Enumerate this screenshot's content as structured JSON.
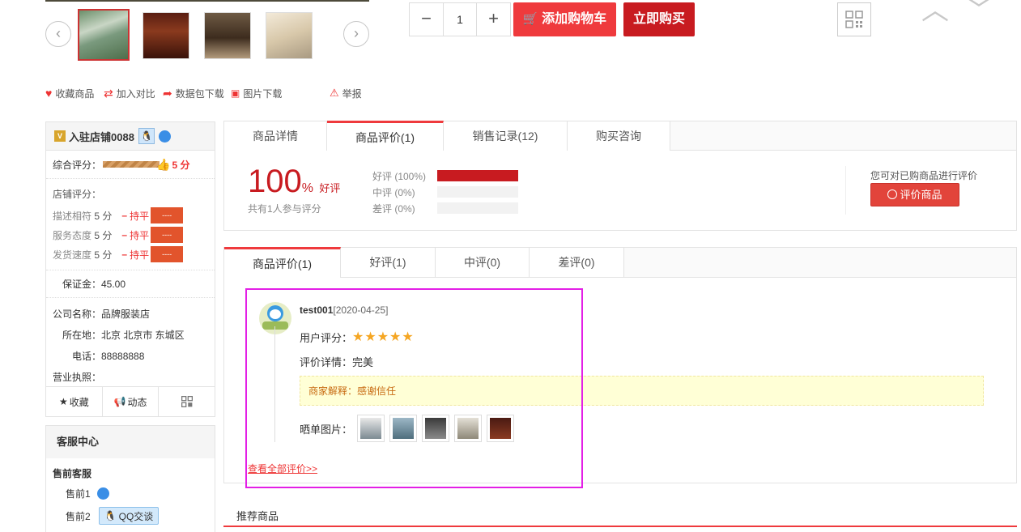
{
  "gallery": {
    "prev_icon": "chevron-left-icon",
    "next_icon": "chevron-right-icon",
    "thumbs": [
      "waterfall-landscape",
      "bookshelf-room",
      "bedroom",
      "living-room"
    ]
  },
  "purchase": {
    "minus": "−",
    "qty": "1",
    "plus": "+",
    "add_to_cart": "添加购物车",
    "buy_now": "立即购买"
  },
  "actions": {
    "favorite": "收藏商品",
    "compare": "加入对比",
    "package": "数据包下载",
    "image_download": "图片下载",
    "report": "举报"
  },
  "store": {
    "name": "入驻店铺0088",
    "overall_label": "综合评分：",
    "overall_score": "5 分",
    "shop_score_label": "店铺评分：",
    "scores": [
      {
        "label": "描述相符",
        "value": "5 分",
        "trend": "持平",
        "pill": "----"
      },
      {
        "label": "服务态度",
        "value": "5 分",
        "trend": "持平",
        "pill": "----"
      },
      {
        "label": "发货速度",
        "value": "5 分",
        "trend": "持平",
        "pill": "----"
      }
    ],
    "deposit": "保证金：45.00",
    "company": "公司名称：品牌服装店",
    "location": "所在地：北京 北京市 东城区",
    "phone": "电话：88888888",
    "license": "营业执照：",
    "bottom": {
      "favorite": "收藏",
      "dynamic": "动态"
    }
  },
  "service": {
    "title": "客服中心",
    "presale_title": "售前客服",
    "agent1": "售前1",
    "agent2": "售前2",
    "qq_talk": "QQ交谈"
  },
  "tabs_top": [
    {
      "label": "商品详情"
    },
    {
      "label": "商品评价(1)"
    },
    {
      "label": "销售记录(12)"
    },
    {
      "label": "购买咨询"
    }
  ],
  "summary": {
    "percent": "100",
    "percent_sign": "%",
    "good_label": "好评",
    "count_text": "共有1人参与评分",
    "bars": [
      {
        "label": "好评 (100%)",
        "value": 1.0
      },
      {
        "label": "中评 (0%)",
        "value": 0
      },
      {
        "label": "差评 (0%)",
        "value": 0
      }
    ],
    "prompt": "您可对已购商品进行评价",
    "rate_button": "评价商品"
  },
  "tabs_review": [
    {
      "label": "商品评价(1)"
    },
    {
      "label": "好评(1)"
    },
    {
      "label": "中评(0)"
    },
    {
      "label": "差评(0)"
    }
  ],
  "review": {
    "user": "test001",
    "date": "[2020-04-25]",
    "rating_label": "用户评分：",
    "stars": "★★★★★",
    "rating_value": 5,
    "detail_label": "评价详情：完美",
    "reply": "商家解释：感谢信任",
    "photos_label": "晒单图片：",
    "see_all": "查看全部评价>>"
  },
  "recommend": {
    "title": "推荐商品"
  },
  "colors": {
    "accent": "#ef3a3d",
    "buy": "#c81b20",
    "highlight": "#e31fe6"
  }
}
